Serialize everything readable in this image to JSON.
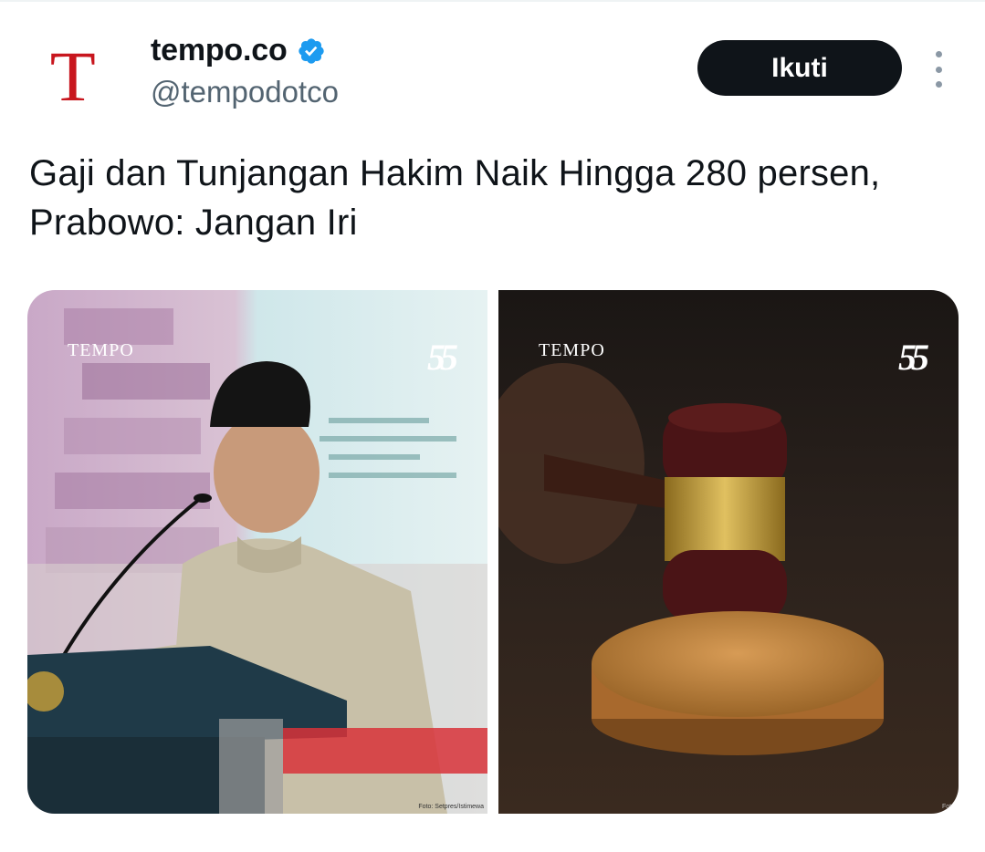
{
  "account": {
    "avatar_letter": "T",
    "display_name": "tempo.co",
    "handle": "@tempodotco",
    "verified": true
  },
  "actions": {
    "follow_label": "Ikuti"
  },
  "tweet": {
    "text": "Gaji dan Tunjangan Hakim Naik Hingga 280 persen, Prabowo: Jangan Iri"
  },
  "media": [
    {
      "watermark": "TEMPO",
      "badge": "55",
      "credit": "Foto: Setpres/Istimewa"
    },
    {
      "watermark": "TEMPO",
      "badge": "55",
      "credit": "Foto"
    }
  ],
  "colors": {
    "brand_red": "#c8161e",
    "verified_blue": "#1d9bf0",
    "follow_button": "#0f1419",
    "secondary_text": "#536471"
  }
}
